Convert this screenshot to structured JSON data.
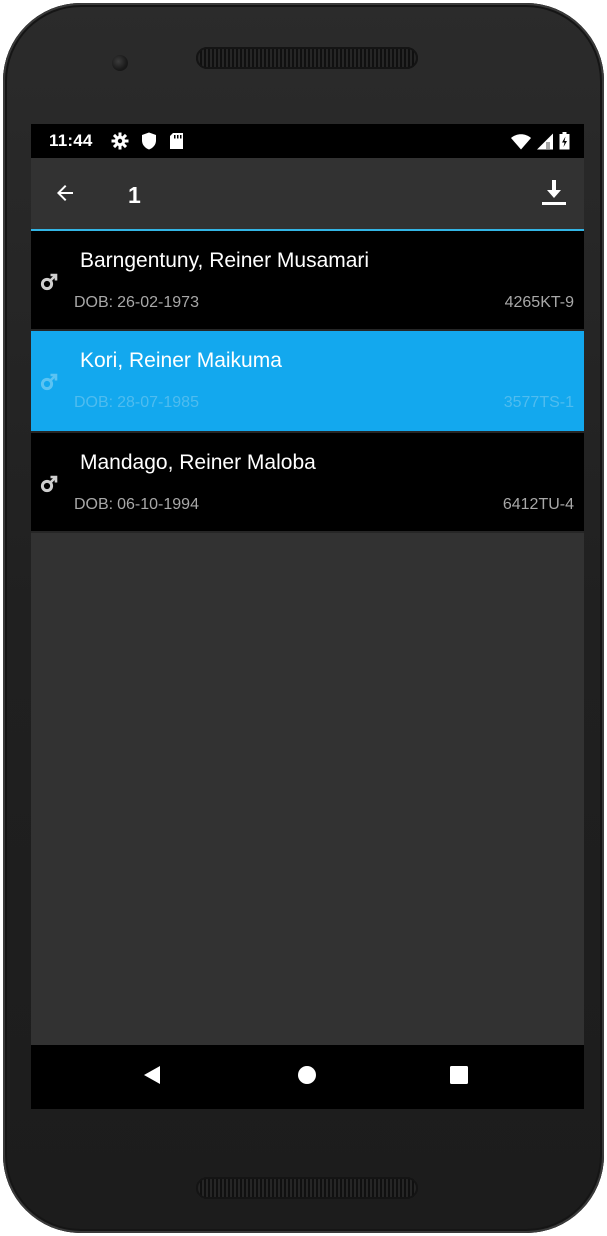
{
  "status_bar": {
    "time": "11:44",
    "left_icons": [
      "settings-icon",
      "shield-icon",
      "sd-card-icon"
    ],
    "right_icons": [
      "wifi-icon",
      "signal-icon",
      "battery-icon"
    ]
  },
  "app_bar": {
    "title": "1",
    "back_icon": "arrow-back-icon",
    "action_icon": "download-icon"
  },
  "patients": [
    {
      "name": "Barngentuny, Reiner Musamari",
      "dob_label": "DOB:",
      "dob": "26-02-1973",
      "record_id": "4265KT-9",
      "gender_icon": "male-icon",
      "selected": false
    },
    {
      "name": "Kori, Reiner Maikuma",
      "dob_label": "DOB:",
      "dob": "28-07-1985",
      "record_id": "3577TS-1",
      "gender_icon": "male-icon",
      "selected": true
    },
    {
      "name": "Mandago, Reiner Maloba",
      "dob_label": "DOB:",
      "dob": "06-10-1994",
      "record_id": "6412TU-4",
      "gender_icon": "male-icon",
      "selected": false
    }
  ],
  "nav_bar": {
    "buttons": [
      "nav-back-icon",
      "nav-home-icon",
      "nav-recents-icon"
    ]
  },
  "colors": {
    "accent": "#33b5e5",
    "selected_row": "#13a8ee",
    "background": "#323232",
    "row_background": "#000000",
    "secondary_text": "#a8a8a8"
  }
}
